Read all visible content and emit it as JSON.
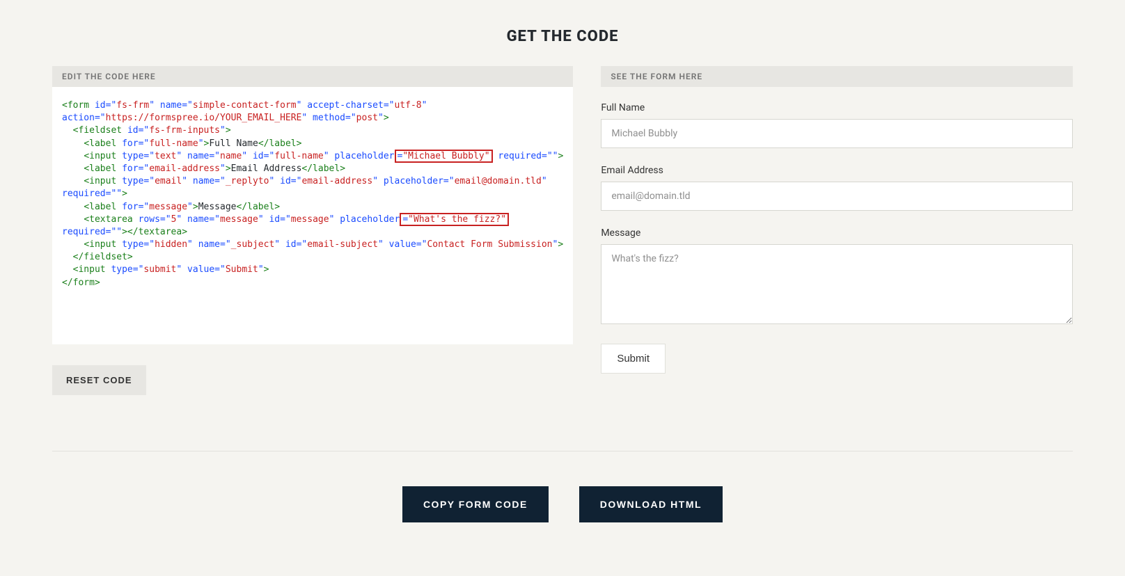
{
  "title": "GET THE CODE",
  "left": {
    "header": "EDIT THE CODE HERE",
    "reset": "RESET CODE"
  },
  "right": {
    "header": "SEE THE FORM HERE",
    "labels": {
      "fullname": "Full Name",
      "email": "Email Address",
      "message": "Message"
    },
    "placeholders": {
      "fullname": "Michael Bubbly",
      "email": "email@domain.tld",
      "message": "What's the fizz?"
    },
    "submit": "Submit"
  },
  "actions": {
    "copy": "COPY FORM CODE",
    "download": "DOWNLOAD HTML"
  },
  "code": {
    "form_id": "fs-frm",
    "form_name": "simple-contact-form",
    "accept_charset": "utf-8",
    "action": "https://formspree.io/YOUR_EMAIL_HERE",
    "method": "post",
    "fieldset_id": "fs-frm-inputs",
    "label_fullname_for": "full-name",
    "label_fullname_text": "Full Name",
    "input_name_type": "text",
    "input_name_name": "name",
    "input_name_id": "full-name",
    "input_name_placeholder": "\"Michael Bubbly\"",
    "input_name_required": "",
    "label_email_for": "email-address",
    "label_email_text": "Email Address",
    "input_email_type": "email",
    "input_email_name": "_replyto",
    "input_email_id": "email-address",
    "input_email_placeholder": "email@domain.tld",
    "input_email_required": "",
    "label_msg_for": "message",
    "label_msg_text": "Message",
    "textarea_rows": "5",
    "textarea_name": "message",
    "textarea_id": "message",
    "textarea_placeholder": "\"What's the fizz?\"",
    "textarea_required": "",
    "hidden_type": "hidden",
    "hidden_name": "_subject",
    "hidden_id": "email-subject",
    "hidden_value": "Contact Form Submission",
    "submit_type": "submit",
    "submit_value": "Submit"
  }
}
